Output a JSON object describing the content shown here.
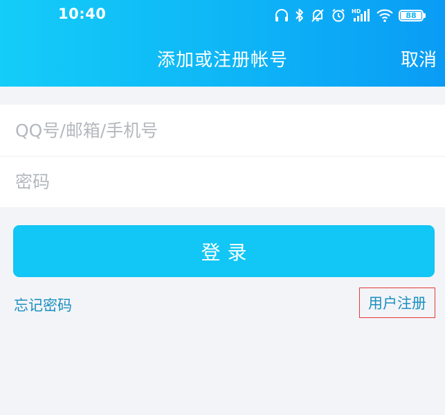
{
  "status_bar": {
    "time": "10:40",
    "battery_level": "88",
    "icons": [
      "headphones-icon",
      "bluetooth-icon",
      "silent-icon",
      "alarm-icon",
      "hd-signal-icon",
      "wifi-icon",
      "battery-icon"
    ]
  },
  "header": {
    "title": "添加或注册帐号",
    "cancel_label": "取消"
  },
  "form": {
    "account_placeholder": "QQ号/邮箱/手机号",
    "password_placeholder": "密码"
  },
  "actions": {
    "login_label": "登录",
    "forgot_password_label": "忘记密码",
    "register_label": "用户注册"
  },
  "colors": {
    "header_gradient_start": "#14cdf8",
    "header_gradient_end": "#0a9cf5",
    "login_button": "#12c6f5",
    "link": "#1a8fbf",
    "highlight_border": "#e53935"
  }
}
